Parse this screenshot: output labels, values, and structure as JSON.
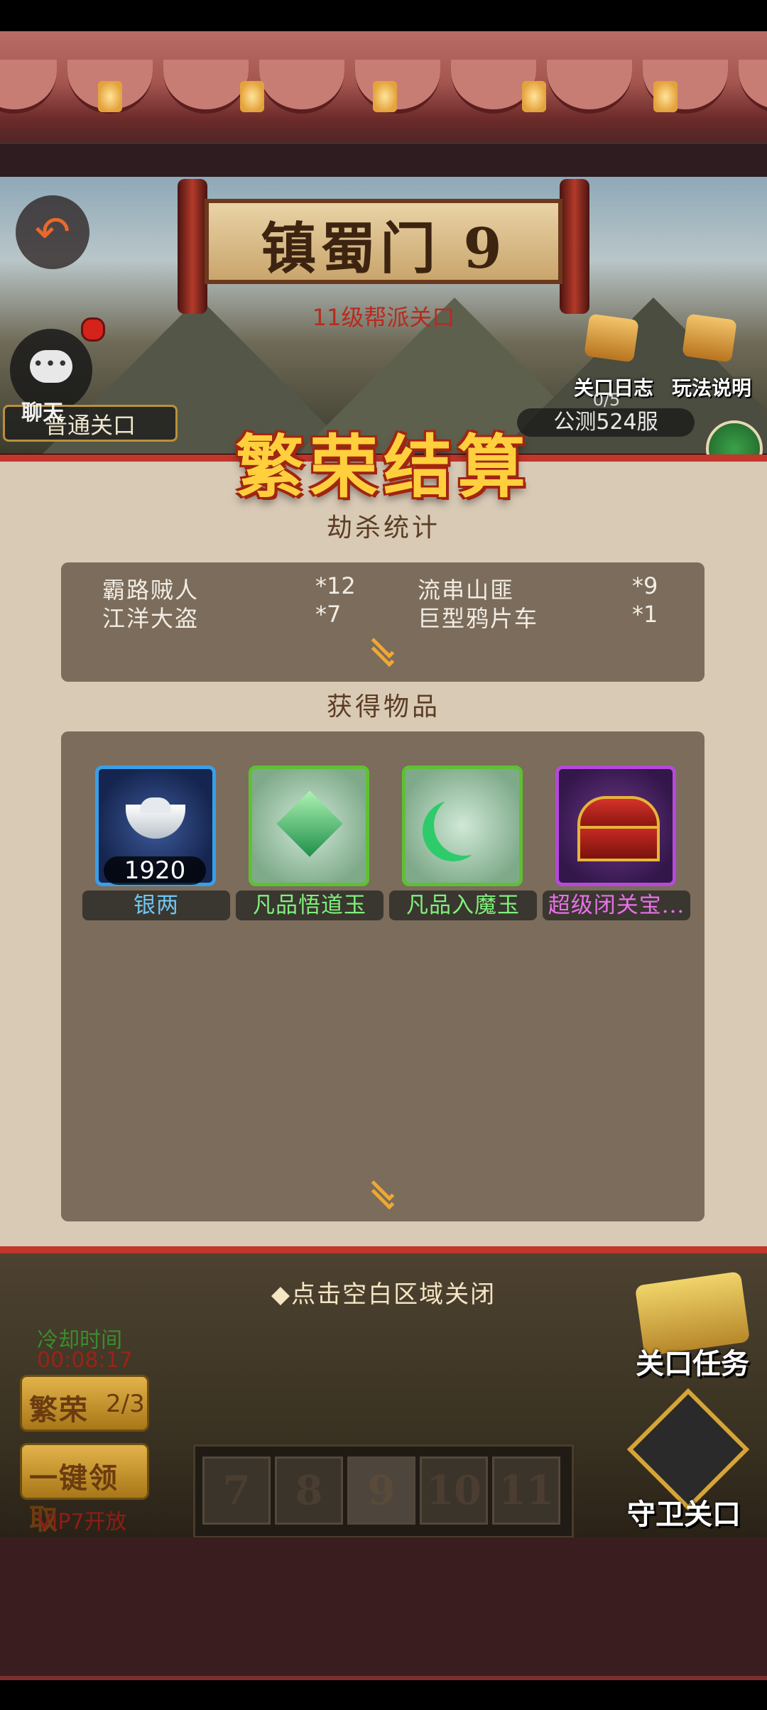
{
  "scene": {
    "zone_title": "镇蜀门 9",
    "zone_subtitle": "11级帮派关口",
    "chat_label": "聊天",
    "mode_label": "普通关口",
    "log_label": "关口日志",
    "rules_label": "玩法说明",
    "progress": "0/5",
    "server": "公测524服"
  },
  "panel": {
    "title": "繁荣结算",
    "kill_title": "劫杀统计",
    "kills": [
      {
        "name": "霸路贼人",
        "count": "*12"
      },
      {
        "name": "流串山匪",
        "count": "*9"
      },
      {
        "name": "江洋大盗",
        "count": "*7"
      },
      {
        "name": "巨型鸦片车",
        "count": "*1"
      }
    ],
    "loot_title": "获得物品",
    "items": [
      {
        "name": "银两",
        "count": "1920",
        "icon": "silver-ingot-icon",
        "name_color": "#6ec6f0",
        "frame_color": "#3a9ee8"
      },
      {
        "name": "凡品悟道玉",
        "icon": "green-jade-crystal-icon",
        "name_color": "#7ff07a",
        "frame_color": "#5fc033"
      },
      {
        "name": "凡品入魔玉",
        "icon": "green-crescent-jade-icon",
        "name_color": "#7ff07a",
        "frame_color": "#5fc033"
      },
      {
        "name": "超级闭关宝...",
        "icon": "treasure-chest-icon",
        "name_color": "#e870e8",
        "frame_color": "#b44ad8"
      }
    ]
  },
  "bottom": {
    "close_hint": "◆点击空白区域关闭",
    "cooldown_label": "冷却时间",
    "cooldown_value": "00:08:17",
    "prosper_label": "繁荣",
    "prosper_count": "2/3",
    "oneclick_label": "一键领取",
    "vip_label": "VIP7开放",
    "levels": [
      "7",
      "8",
      "9",
      "10",
      "11"
    ],
    "task_label": "关口任务",
    "guard_label": "守卫关口"
  },
  "colors": {
    "panel_bg": "#d9cab6",
    "panel_border": "#c2362b",
    "box_bg": "#7b6c5b",
    "title_gold": "#ffcf3d"
  }
}
